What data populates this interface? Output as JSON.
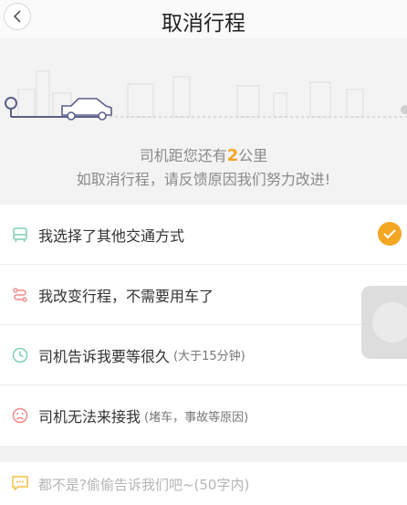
{
  "nav": {
    "title": "取消行程"
  },
  "hero": {
    "distance_prefix": "司机距您还有",
    "distance_value": "2",
    "distance_suffix": "公里",
    "feedback_prompt": "如取消行程，请反馈原因我们努力改进!"
  },
  "reasons": {
    "items": [
      {
        "label": "我选择了其他交通方式",
        "note": "",
        "icon": "transit-icon",
        "selected": true
      },
      {
        "label": "我改变行程，不需要用车了",
        "note": "",
        "icon": "route-change-icon",
        "selected": false
      },
      {
        "label": "司机告诉我要等很久",
        "note": "(大于15分钟)",
        "icon": "clock-icon",
        "selected": false
      },
      {
        "label": "司机无法来接我",
        "note": "(堵车，事故等原因)",
        "icon": "sad-face-icon",
        "selected": false
      }
    ]
  },
  "comment": {
    "placeholder": "都不是?偷偷告诉我们吧~(50字内)"
  },
  "colors": {
    "accent": "#f5a623",
    "route": "#5b5f8a",
    "icon_green": "#7ecfb6"
  }
}
